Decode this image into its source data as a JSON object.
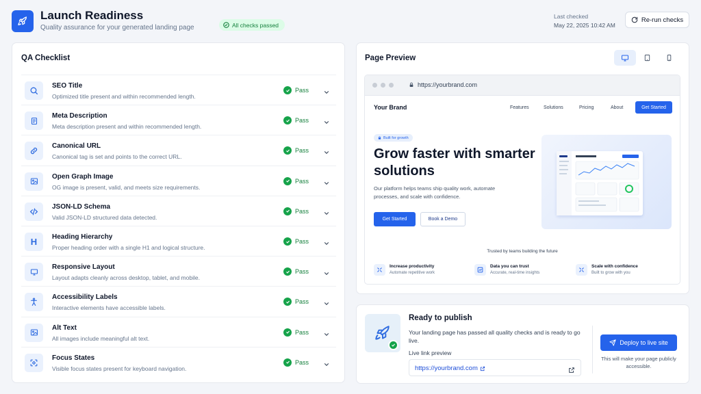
{
  "header": {
    "title": "Launch Readiness",
    "subtitle": "Quality assurance for your generated landing page",
    "status_badge": "All checks passed",
    "last_checked_label": "Last checked",
    "last_checked_value": "May 22, 2025 10:42 AM",
    "rerun_label": "Re-run checks",
    "icon": "rocket-icon"
  },
  "checklist": {
    "title": "QA Checklist",
    "items": [
      {
        "icon": "search-icon",
        "title": "SEO Title",
        "desc": "Optimized title present and within recommended length.",
        "status": "Pass"
      },
      {
        "icon": "document-icon",
        "title": "Meta Description",
        "desc": "Meta description present and within recommended length.",
        "status": "Pass"
      },
      {
        "icon": "link-icon",
        "title": "Canonical URL",
        "desc": "Canonical tag is set and points to the correct URL.",
        "status": "Pass"
      },
      {
        "icon": "image-icon",
        "title": "Open Graph Image",
        "desc": "OG image is present, valid, and meets size requirements.",
        "status": "Pass"
      },
      {
        "icon": "code-icon",
        "title": "JSON-LD Schema",
        "desc": "Valid JSON-LD structured data detected.",
        "status": "Pass"
      },
      {
        "icon": "heading-icon",
        "glyph": "H",
        "title": "Heading Hierarchy",
        "desc": "Proper heading order with a single H1 and logical structure.",
        "status": "Pass"
      },
      {
        "icon": "monitor-icon",
        "title": "Responsive Layout",
        "desc": "Layout adapts cleanly across desktop, tablet, and mobile.",
        "status": "Pass"
      },
      {
        "icon": "accessibility-icon",
        "title": "Accessibility Labels",
        "desc": "Interactive elements have accessible labels.",
        "status": "Pass"
      },
      {
        "icon": "image-icon",
        "title": "Alt Text",
        "desc": "All images include meaningful alt text.",
        "status": "Pass"
      },
      {
        "icon": "focus-icon",
        "title": "Focus States",
        "desc": "Visible focus states present for keyboard navigation.",
        "status": "Pass"
      }
    ]
  },
  "preview": {
    "title": "Page Preview",
    "devices": [
      "desktop-icon",
      "tablet-icon",
      "mobile-icon"
    ],
    "active_device": "desktop",
    "url": "https://yourbrand.com",
    "site": {
      "brand": "Your Brand",
      "nav": [
        "Features",
        "Solutions",
        "Pricing",
        "About"
      ],
      "nav_cta": "Get Started",
      "hero_badge": "Built for growth",
      "hero_title": "Grow faster with smarter solutions",
      "hero_sub": "Our platform helps teams ship quality work, automate processes, and scale with confidence.",
      "primary_cta": "Get Started",
      "secondary_cta": "Book a Demo",
      "trusted": "Trusted by teams building the future",
      "features": [
        {
          "title": "Increase productivity",
          "desc": "Automate repetitive work"
        },
        {
          "title": "Data you can trust",
          "desc": "Accurate, real-time insights"
        },
        {
          "title": "Scale with confidence",
          "desc": "Built to grow with you"
        }
      ]
    }
  },
  "publish": {
    "title": "Ready to publish",
    "desc": "Your landing page has passed all quality checks and is ready to go live.",
    "link_label": "Live link preview",
    "link": "https://yourbrand.com",
    "deploy_label": "Deploy to live site",
    "deploy_note": "This will make your page publicly accessible."
  },
  "colors": {
    "accent": "#2563eb",
    "success": "#16a34a",
    "background": "#f3f5f9"
  }
}
